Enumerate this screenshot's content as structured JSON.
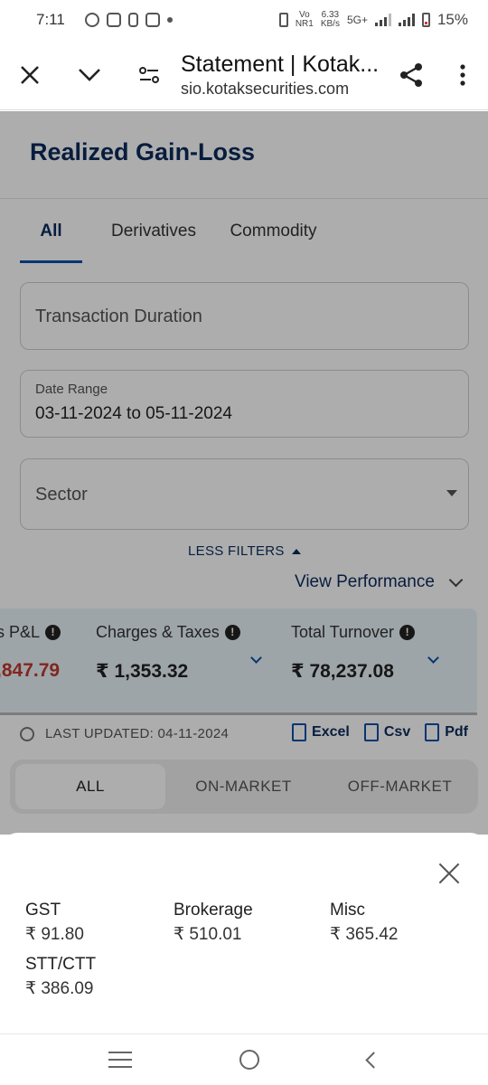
{
  "status_bar": {
    "time": "7:11",
    "network_label": "Vo NR1",
    "speed": "6.33",
    "speed_unit": "KB/s",
    "network_type": "5G+",
    "battery": "15%"
  },
  "browser": {
    "title": "Statement | Kotak...",
    "url": "sio.kotaksecurities.com"
  },
  "page": {
    "title": "Realized Gain-Loss",
    "tabs": [
      {
        "label": "All"
      },
      {
        "label": "Derivatives"
      },
      {
        "label": "Commodity"
      }
    ],
    "filters": {
      "transaction_duration_placeholder": "Transaction Duration",
      "date_range_label": "Date Range",
      "date_range_value": "03-11-2024 to 05-11-2024",
      "sector_placeholder": "Sector"
    },
    "less_filters": "LESS FILTERS",
    "view_performance": "View Performance",
    "summary": [
      {
        "title": "s P&L",
        "value": ",847.79"
      },
      {
        "title": "Charges & Taxes",
        "value": "₹ 1,353.32"
      },
      {
        "title": "Total Turnover",
        "value": "₹ 78,237.08"
      }
    ],
    "last_updated": "LAST UPDATED: 04-11-2024",
    "exports": {
      "excel": "Excel",
      "csv": "Csv",
      "pdf": "Pdf"
    },
    "segments": [
      {
        "label": "ALL"
      },
      {
        "label": "ON-MARKET"
      },
      {
        "label": "OFF-MARKET"
      }
    ]
  },
  "sheet": {
    "items": [
      {
        "label": "GST",
        "value": "₹ 91.80"
      },
      {
        "label": "Brokerage",
        "value": "₹ 510.01"
      },
      {
        "label": "Misc",
        "value": "₹ 365.42"
      },
      {
        "label": "STT/CTT",
        "value": "₹ 386.09"
      }
    ]
  },
  "colors": {
    "brand_navy": "#0b2c5c",
    "accent_blue": "#0b4fa8",
    "loss_red": "#c0392b",
    "summary_bg": "#e9f4f9"
  }
}
